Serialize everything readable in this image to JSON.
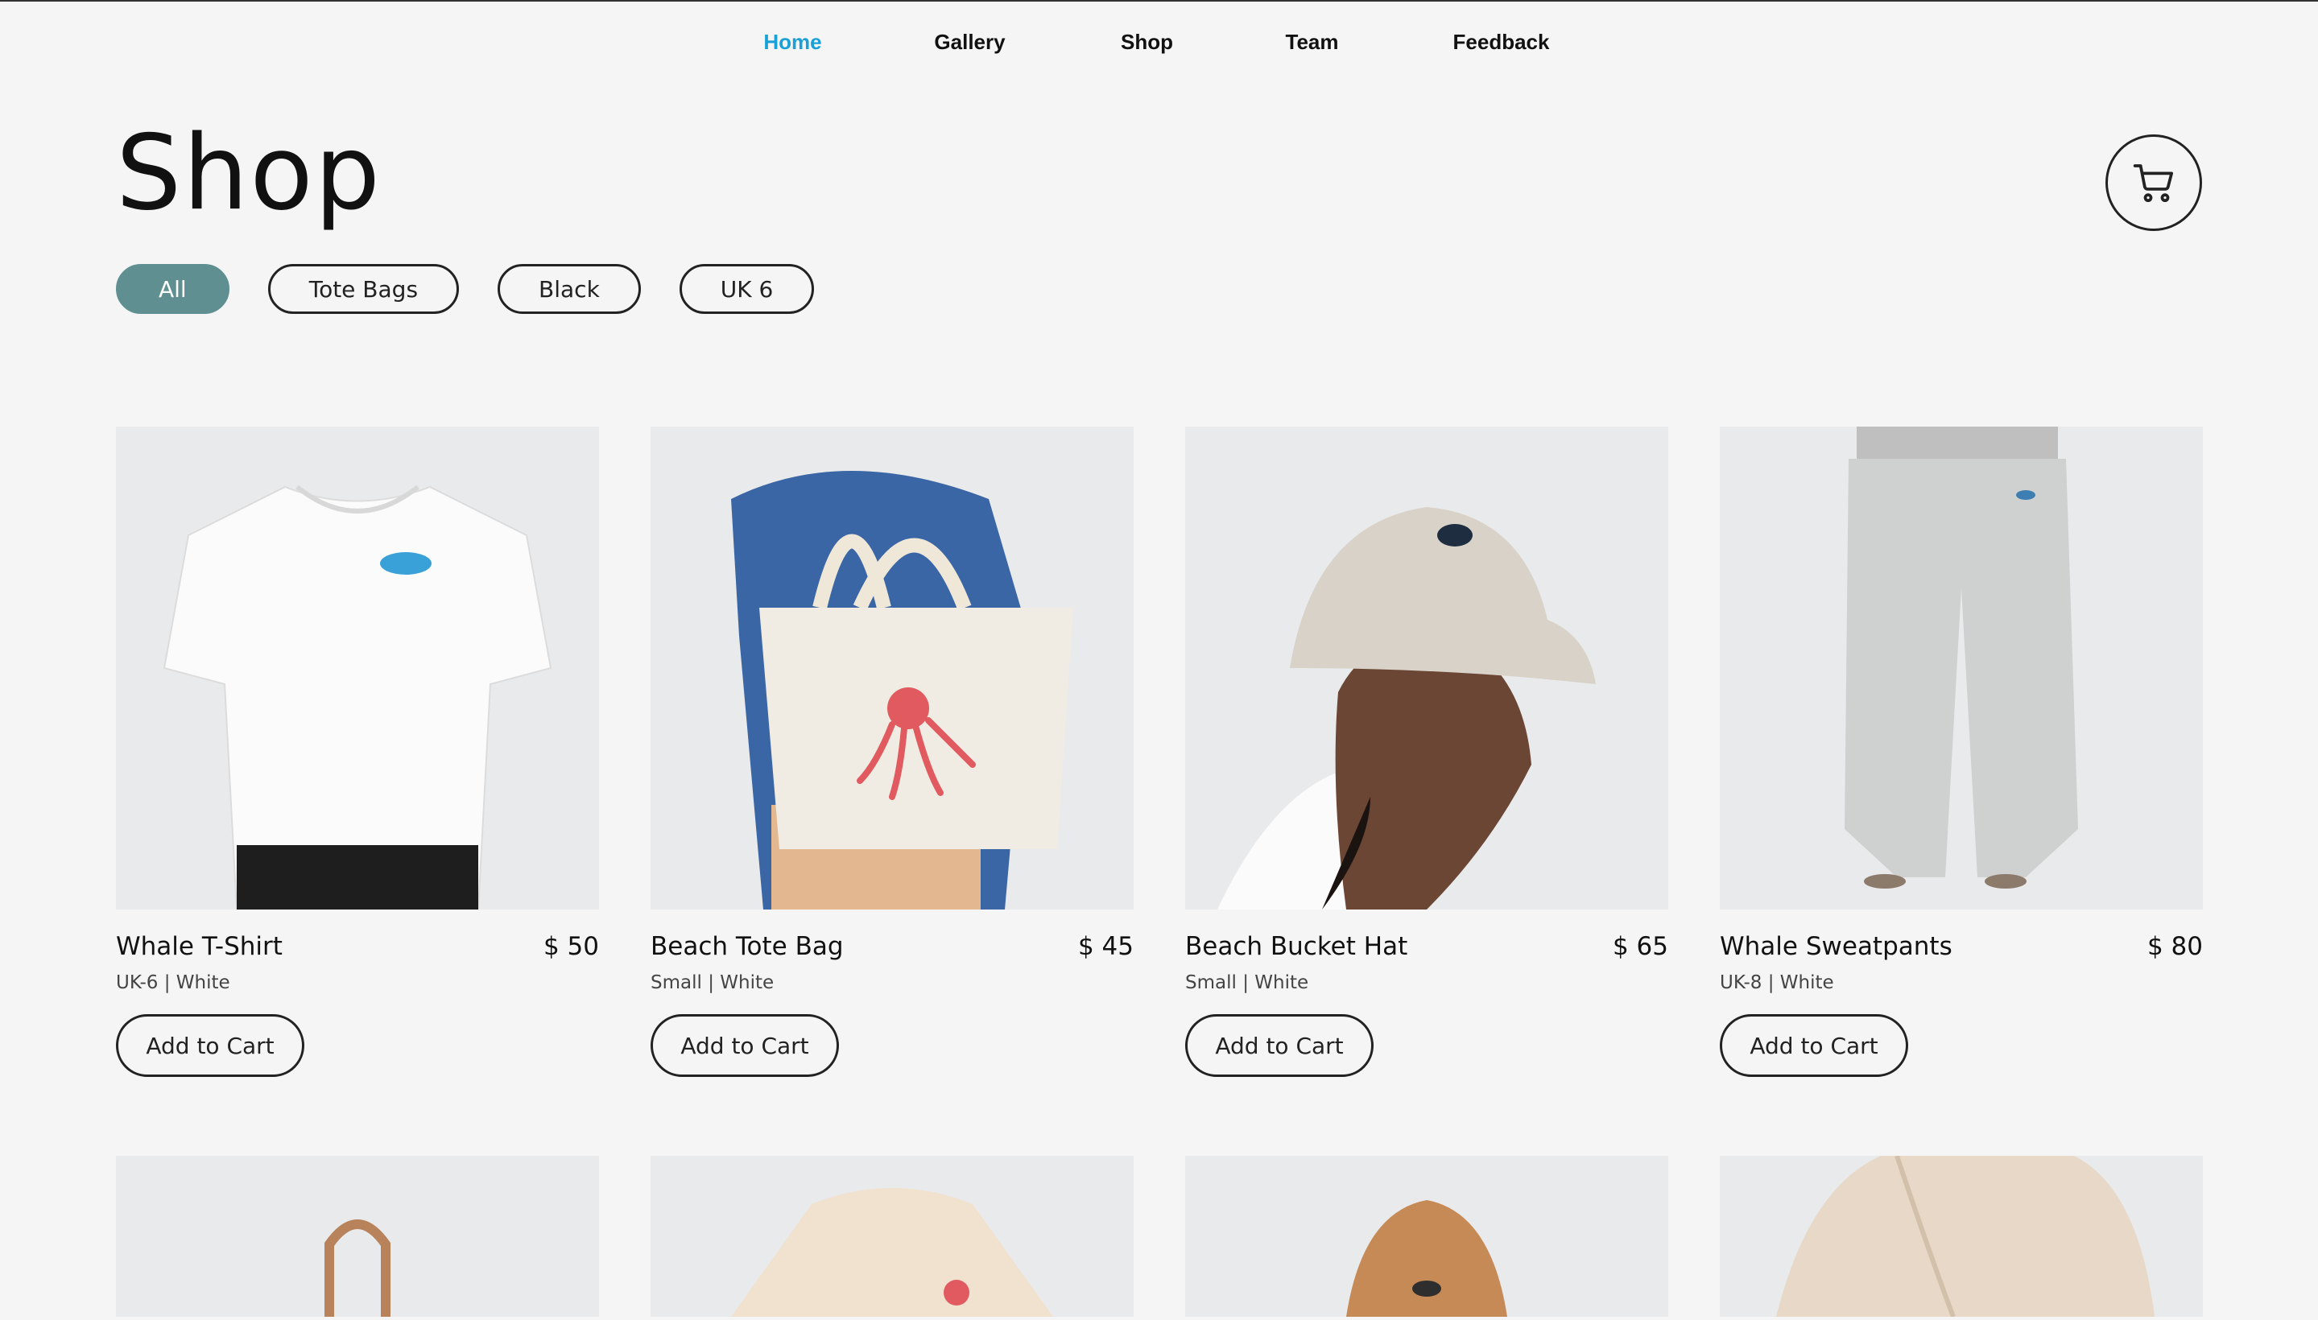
{
  "nav": {
    "items": [
      {
        "label": "Home",
        "active": true
      },
      {
        "label": "Gallery",
        "active": false
      },
      {
        "label": "Shop",
        "active": false
      },
      {
        "label": "Team",
        "active": false
      },
      {
        "label": "Feedback",
        "active": false
      }
    ]
  },
  "header": {
    "title": "Shop",
    "cart_icon": "shopping-cart-icon"
  },
  "filters": [
    {
      "label": "All",
      "active": true
    },
    {
      "label": "Tote Bags",
      "active": false
    },
    {
      "label": "Black",
      "active": false
    },
    {
      "label": "UK 6",
      "active": false
    }
  ],
  "products": [
    {
      "name": "Whale T-Shirt",
      "price": "$ 50",
      "variant": "UK-6 | White",
      "button": "Add to Cart"
    },
    {
      "name": "Beach Tote Bag",
      "price": "$ 45",
      "variant": "Small | White",
      "button": "Add to Cart"
    },
    {
      "name": "Beach Bucket Hat",
      "price": "$ 65",
      "variant": "Small | White",
      "button": "Add to Cart"
    },
    {
      "name": "Whale Sweatpants",
      "price": "$ 80",
      "variant": "UK-8 | White",
      "button": "Add to Cart"
    }
  ],
  "colors": {
    "accent": "#1aa0d8",
    "chip_active": "#5f8f91",
    "background": "#f5f5f5",
    "card_bg": "#e9eaeb"
  }
}
